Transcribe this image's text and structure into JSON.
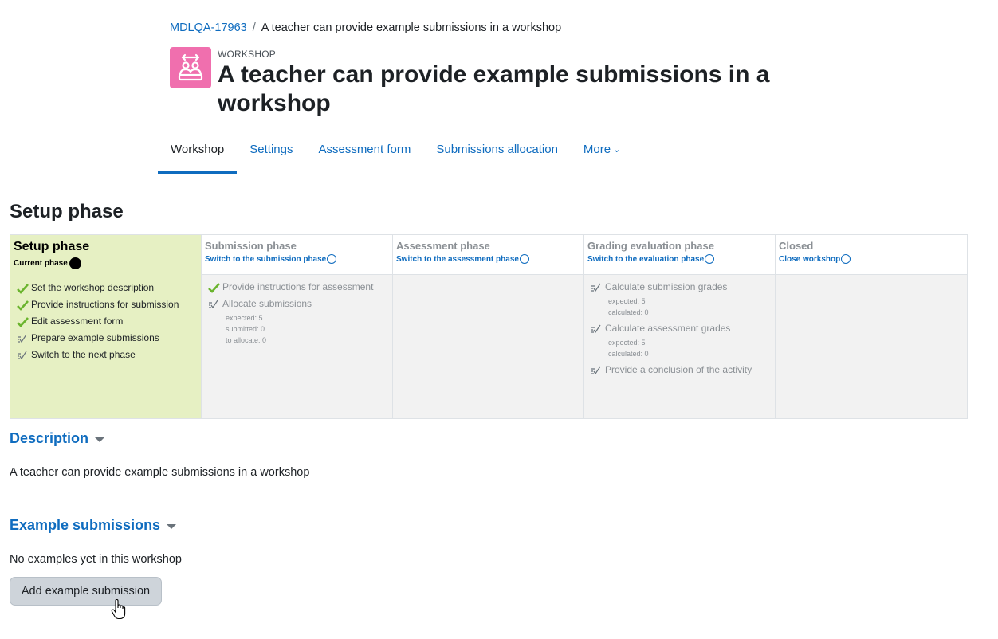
{
  "breadcrumb": {
    "course": "MDLQA-17963",
    "separator": "/",
    "current": "A teacher can provide example submissions in a workshop"
  },
  "header": {
    "module_type": "WORKSHOP",
    "title": "A teacher can provide example submissions in a workshop",
    "icon": "workshop-icon",
    "icon_color": "#f06fae"
  },
  "nav": {
    "tabs": [
      {
        "label": "Workshop",
        "active": true
      },
      {
        "label": "Settings"
      },
      {
        "label": "Assessment form"
      },
      {
        "label": "Submissions allocation"
      },
      {
        "label": "More"
      }
    ]
  },
  "phase_heading": "Setup phase",
  "userplan": {
    "phases": [
      {
        "name": "Setup phase",
        "action": "Current phase",
        "current": true,
        "tasks": [
          {
            "label": "Set the workshop description",
            "status": "done"
          },
          {
            "label": "Provide instructions for submission",
            "status": "done"
          },
          {
            "label": "Edit assessment form",
            "status": "done"
          },
          {
            "label": "Prepare example submissions",
            "status": "todo"
          },
          {
            "label": "Switch to the next phase",
            "status": "todo"
          }
        ]
      },
      {
        "name": "Submission phase",
        "action": "Switch to the submission phase",
        "tasks": [
          {
            "label": "Provide instructions for assessment",
            "status": "done"
          },
          {
            "label": "Allocate submissions",
            "status": "todo",
            "details": [
              "expected: 5",
              "submitted: 0",
              "to allocate: 0"
            ]
          }
        ]
      },
      {
        "name": "Assessment phase",
        "action": "Switch to the assessment phase",
        "tasks": []
      },
      {
        "name": "Grading evaluation phase",
        "action": "Switch to the evaluation phase",
        "tasks": [
          {
            "label": "Calculate submission grades",
            "status": "todo",
            "details": [
              "expected: 5",
              "calculated: 0"
            ]
          },
          {
            "label": "Calculate assessment grades",
            "status": "todo",
            "details": [
              "expected: 5",
              "calculated: 0"
            ]
          },
          {
            "label": "Provide a conclusion of the activity",
            "status": "todo"
          }
        ]
      },
      {
        "name": "Closed",
        "action": "Close workshop",
        "tasks": []
      }
    ],
    "colors": {
      "current_bg": "#e6f0c3",
      "done_check": "#6ab42d",
      "inactive_bg": "#f2f2f2"
    }
  },
  "description": {
    "title": "Description",
    "text": "A teacher can provide example submissions in a workshop"
  },
  "examples": {
    "title": "Example submissions",
    "empty_text": "No examples yet in this workshop",
    "add_button": "Add example submission"
  }
}
